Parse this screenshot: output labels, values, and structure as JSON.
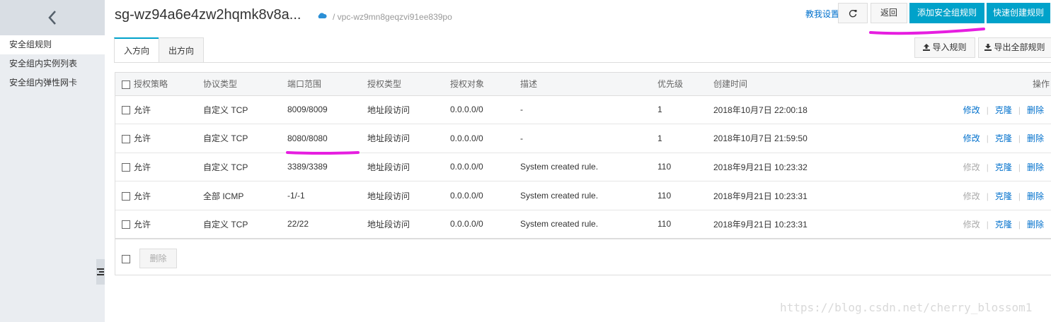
{
  "sidebar": {
    "items": [
      {
        "label": "安全组规则"
      },
      {
        "label": "安全组内实例列表"
      },
      {
        "label": "安全组内弹性网卡"
      }
    ]
  },
  "header": {
    "title": "sg-wz94a6e4zw2hqmk8v8a...",
    "vpc": "/ vpc-wz9mn8geqzvi91ee839po",
    "help_link": "教我设置",
    "back_label": "返回",
    "add_label": "添加安全组规则",
    "quick_label": "快速创建规则"
  },
  "tabs": [
    {
      "label": "入方向"
    },
    {
      "label": "出方向"
    }
  ],
  "toolbar": {
    "import_label": "导入规则",
    "export_label": "导出全部规则"
  },
  "table": {
    "headers": [
      "授权策略",
      "协议类型",
      "端口范围",
      "授权类型",
      "授权对象",
      "描述",
      "优先级",
      "创建时间",
      "操作"
    ],
    "rows": [
      {
        "policy": "允许",
        "protocol": "自定义 TCP",
        "port": "8009/8009",
        "auth_type": "地址段访问",
        "object": "0.0.0.0/0",
        "desc": "-",
        "priority": "1",
        "created": "2018年10月7日 22:00:18"
      },
      {
        "policy": "允许",
        "protocol": "自定义 TCP",
        "port": "8080/8080",
        "auth_type": "地址段访问",
        "object": "0.0.0.0/0",
        "desc": "-",
        "priority": "1",
        "created": "2018年10月7日 21:59:50"
      },
      {
        "policy": "允许",
        "protocol": "自定义 TCP",
        "port": "3389/3389",
        "auth_type": "地址段访问",
        "object": "0.0.0.0/0",
        "desc": "System created rule.",
        "priority": "110",
        "created": "2018年9月21日 10:23:32"
      },
      {
        "policy": "允许",
        "protocol": "全部 ICMP",
        "port": "-1/-1",
        "auth_type": "地址段访问",
        "object": "0.0.0.0/0",
        "desc": "System created rule.",
        "priority": "110",
        "created": "2018年9月21日 10:23:31"
      },
      {
        "policy": "允许",
        "protocol": "自定义 TCP",
        "port": "22/22",
        "auth_type": "地址段访问",
        "object": "0.0.0.0/0",
        "desc": "System created rule.",
        "priority": "110",
        "created": "2018年9月21日 10:23:31"
      }
    ],
    "actions": {
      "edit": "修改",
      "clone": "克隆",
      "delete": "删除"
    },
    "bulk_delete": "删除"
  },
  "watermark": "https://blog.csdn.net/cherry_blossom1",
  "colors": {
    "accent": "#00a2ca",
    "link": "#0070cc",
    "annotation": "#e61ee0"
  }
}
